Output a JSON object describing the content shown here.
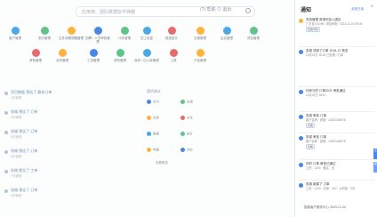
{
  "header": {
    "search_placeholder": "应用搜、团队数据协作神器",
    "right_actions": "(?) 帮助  ⊙ 退出"
  },
  "apps": [
    {
      "label": "客户管理",
      "color": "#4aa8e8"
    },
    {
      "label": "签约管理",
      "color": "#5fc48a"
    },
    {
      "label": "正件到期提醒管理",
      "color": "#ffb33a"
    },
    {
      "label": "招聘 / 人员审批管理",
      "color": "#4a86e8"
    },
    {
      "label": "计件管理",
      "color": "#5fc48a"
    },
    {
      "label": "员工信息",
      "color": "#4aa8e8"
    },
    {
      "label": "报表统计",
      "color": "#e86b6b"
    },
    {
      "label": "日程管理",
      "color": "#ffb33a"
    },
    {
      "label": "会议管理",
      "color": "#4aa8e8"
    },
    {
      "label": "项目管理",
      "color": "#5fc48a"
    },
    {
      "label": "考勤管理",
      "color": "#e86b6b"
    },
    {
      "label": "合同管理",
      "color": "#ffb33a"
    },
    {
      "label": "工资管理",
      "color": "#4a86e8"
    },
    {
      "label": "采购管理",
      "color": "#5fc48a"
    },
    {
      "label": "库存 / 出入库管理",
      "color": "#4aa8e8"
    },
    {
      "label": "工具",
      "color": "#e86b6b"
    },
    {
      "label": "产品管理",
      "color": "#ffb33a"
    }
  ],
  "activity": [
    {
      "a": "项目数据 预告了 静态订单",
      "b": "1分钟前"
    },
    {
      "a": "张城 预告了 订单",
      "b": "2分钟前"
    },
    {
      "a": "张城 预告了 订单",
      "b": "3分钟前"
    },
    {
      "a": "张城 预告了 订单",
      "b": "5分钟前"
    },
    {
      "a": "系统 提交了 工单",
      "b": "7分钟前"
    },
    {
      "a": "张城 预告了 订单",
      "b": "9分钟前"
    }
  ],
  "midstats": {
    "title": "签约统计",
    "rows": [
      [
        "本月",
        "本周"
      ],
      [
        "本季",
        "本年"
      ],
      [
        "数据",
        "统计"
      ],
      [
        "明细",
        "待办"
      ]
    ],
    "footer": "查看更多"
  },
  "panel": {
    "title": "通知",
    "all_read": "全部已读",
    "close": "×",
    "items": [
      {
        "text": "系统管理 邀请你加入团队",
        "sub": "广东省XX公司 / 项目审批 / 2023-12-03 09:30",
        "action": "查看详情",
        "color": "#ffb33a"
      },
      {
        "text": "张城 领用了订单 2016-12 物流",
        "sub": "12月21日 16:40   已处理 / 订单",
        "action": "",
        "color": "#4a86e8"
      },
      {
        "text": "你参与的 订单2021 审批通过",
        "sub": "12月21日 16:41",
        "action": "",
        "color": "#4a86e8"
      },
      {
        "text": "张城 审批 订单",
        "sub": "客户名称：张城  ·  13512345678",
        "action": "查看",
        "color": "#4a86e8"
      },
      {
        "text": "张城 审批 订单",
        "sub": "客户名称：张城  ·  13512345678",
        "action": "查看",
        "color": "#4a86e8"
      },
      {
        "text": "你的 订单 审批已通过",
        "sub": "工资：1200 · 备注：无",
        "action": "",
        "color": "#4a86e8"
      },
      {
        "text": "张城 新建了 订单",
        "sub": "工资：1200 · 社保：300 · 公积金：200",
        "action": "",
        "color": "#4a86e8"
      }
    ],
    "footer": "智能客户服务中心  2023-12-04"
  }
}
